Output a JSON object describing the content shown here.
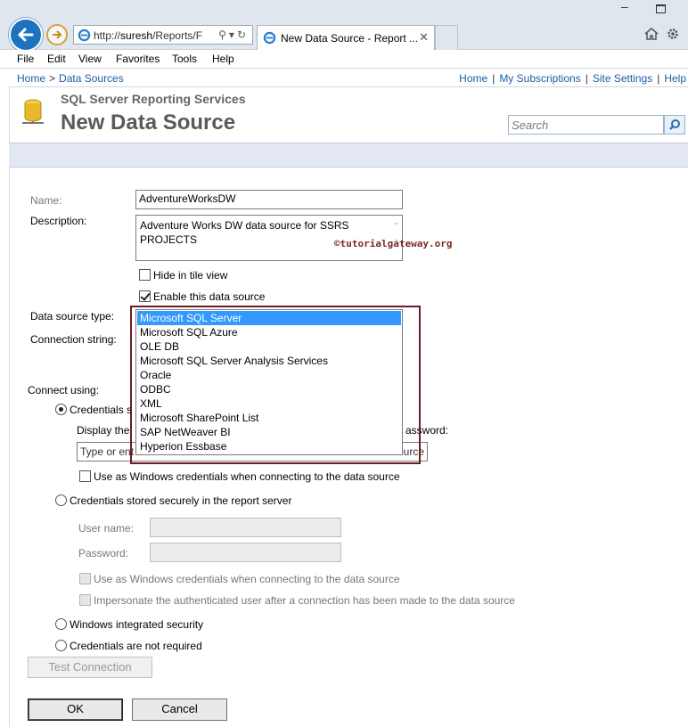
{
  "browser": {
    "url_prefix": "http://",
    "url_host": "suresh",
    "url_path": "/Reports/F",
    "tab_title": "New Data Source - Report ...",
    "menu": [
      "File",
      "Edit",
      "View",
      "Favorites",
      "Tools",
      "Help"
    ]
  },
  "header": {
    "breadcrumb": [
      "Home",
      "Data Sources"
    ],
    "breadcrumb_sep": ">",
    "top_links": [
      "Home",
      "My Subscriptions",
      "Site Settings",
      "Help"
    ],
    "app_title": "SQL Server Reporting Services",
    "page_title": "New Data Source",
    "search_placeholder": "Search"
  },
  "form": {
    "name_label": "Name:",
    "name_value": "AdventureWorksDW",
    "description_label": "Description:",
    "description_value": "Adventure Works DW data source for SSRS PROJECTS",
    "hide_tile_label": "Hide in tile view",
    "enable_label": "Enable this data source",
    "type_label": "Data source type:",
    "connection_label": "Connection string:",
    "connect_using_label": "Connect using:",
    "cred_supplied_label": "Credentials s",
    "display_text_label": "Display the",
    "display_text_tail": "assword:",
    "prompt_value": "Type or ent",
    "prompt_tail": "ource",
    "use_windows_label": "Use as Windows credentials when connecting to the data source",
    "cred_stored_label": "Credentials stored securely in the report server",
    "username_label": "User name:",
    "password_label": "Password:",
    "use_windows_disabled_label": "Use as Windows credentials when connecting to the data source",
    "impersonate_label": "Impersonate the authenticated user after a connection has been made to the data source",
    "windows_integrated_label": "Windows integrated security",
    "not_required_label": "Credentials are not required",
    "test_connection": "Test Connection",
    "ok": "OK",
    "cancel": "Cancel"
  },
  "data_source_types": [
    "Microsoft SQL Server",
    "Microsoft SQL Azure",
    "OLE DB",
    "Microsoft SQL Server Analysis Services",
    "Oracle",
    "ODBC",
    "XML",
    "Microsoft SharePoint List",
    "SAP NetWeaver BI",
    "Hyperion Essbase"
  ],
  "selected_type_index": 0,
  "watermark": "©tutorialgateway.org",
  "colors": {
    "link": "#1c5fa6",
    "selection": "#3399ff",
    "highlight_border": "#6e1a24",
    "band": "#e4e8f5"
  },
  "icons": [
    "back-arrow-icon",
    "forward-arrow-icon",
    "ie-icon",
    "search-icon",
    "refresh-icon",
    "close-icon",
    "home-icon",
    "gear-icon",
    "database-icon"
  ]
}
